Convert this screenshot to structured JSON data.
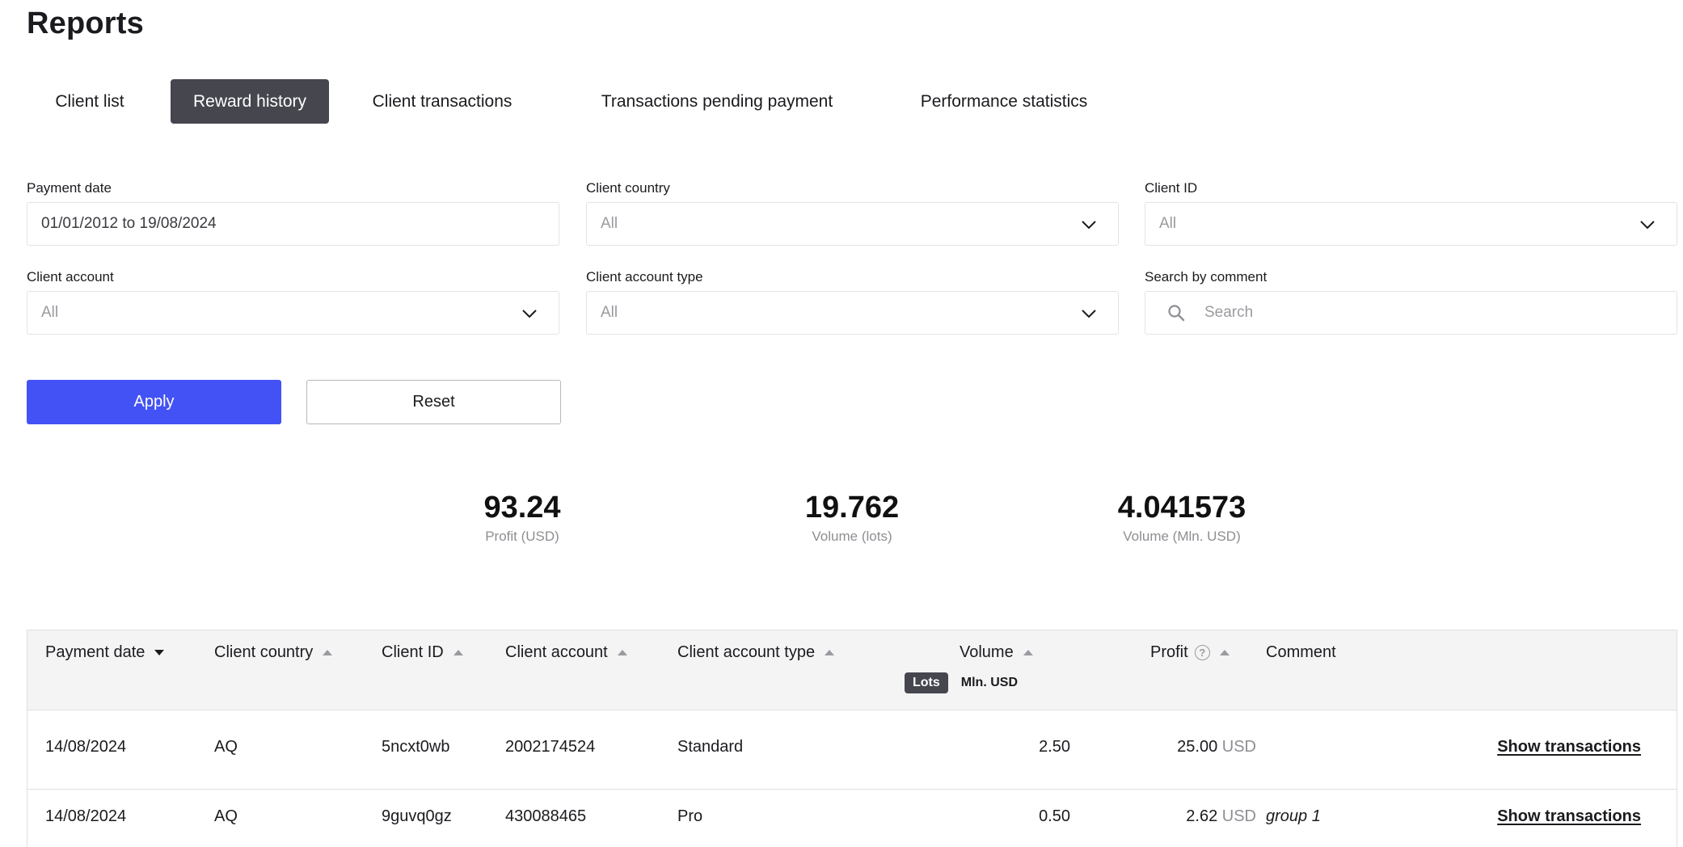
{
  "page": {
    "title": "Reports"
  },
  "tabs": [
    {
      "label": "Client list",
      "active": false
    },
    {
      "label": "Reward history",
      "active": true
    },
    {
      "label": "Client transactions",
      "active": false
    },
    {
      "label": "Transactions pending payment",
      "active": false
    },
    {
      "label": "Performance statistics",
      "active": false
    }
  ],
  "filters": {
    "payment_date": {
      "label": "Payment date",
      "value": "01/01/2012 to 19/08/2024"
    },
    "client_country": {
      "label": "Client country",
      "value": "All"
    },
    "client_id": {
      "label": "Client ID",
      "value": "All"
    },
    "client_account": {
      "label": "Client account",
      "value": "All"
    },
    "client_account_type": {
      "label": "Client account type",
      "value": "All"
    },
    "search_by_comment": {
      "label": "Search by comment",
      "placeholder": "Search"
    }
  },
  "buttons": {
    "apply": "Apply",
    "reset": "Reset"
  },
  "stats": [
    {
      "value": "93.24",
      "label": "Profit (USD)"
    },
    {
      "value": "19.762",
      "label": "Volume (lots)"
    },
    {
      "value": "4.041573",
      "label": "Volume (Mln. USD)"
    }
  ],
  "table": {
    "columns": {
      "payment_date": "Payment date",
      "client_country": "Client country",
      "client_id": "Client ID",
      "client_account": "Client account",
      "client_account_type": "Client account type",
      "volume": "Volume",
      "profit": "Profit",
      "comment": "Comment"
    },
    "volume_units": {
      "active": "Lots",
      "other": "Mln. USD"
    },
    "currency": "USD",
    "rows": [
      {
        "payment_date": "14/08/2024",
        "client_country": "AQ",
        "client_id": "5ncxt0wb",
        "client_account": "2002174524",
        "client_account_type": "Standard",
        "volume": "2.50",
        "profit": "25.00",
        "currency": "USD",
        "comment": "",
        "action": "Show transactions"
      },
      {
        "payment_date": "14/08/2024",
        "client_country": "AQ",
        "client_id": "9guvq0gz",
        "client_account": "430088465",
        "client_account_type": "Pro",
        "volume": "0.50",
        "profit": "2.62",
        "currency": "USD",
        "comment": "group 1",
        "action": "Show transactions"
      }
    ]
  },
  "colors": {
    "accent": "#4352f4",
    "active_tab": "#46464f",
    "muted_text": "#8e8e94",
    "header_bg": "#f4f4f5"
  },
  "icons": {
    "dropdown": "chevron-down-icon",
    "search": "search-icon",
    "help": "help-circle-icon",
    "sort": "sort-arrow-icon"
  }
}
